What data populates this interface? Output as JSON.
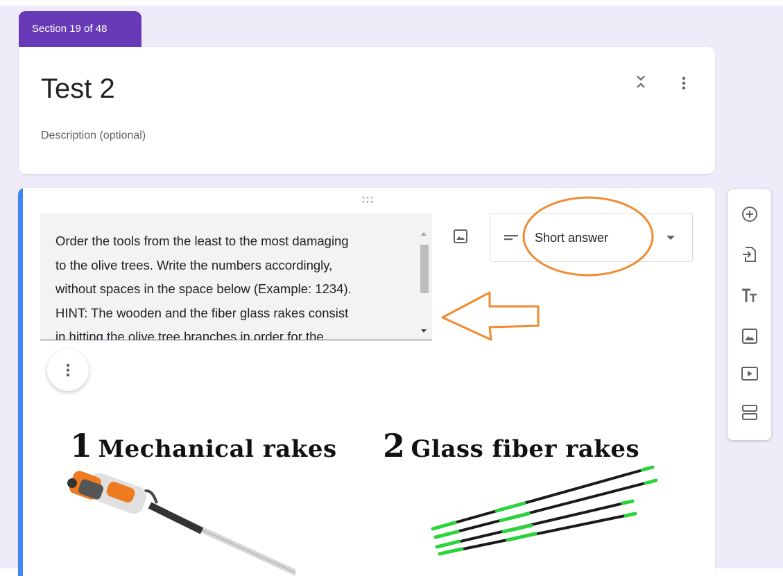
{
  "section": {
    "label": "Section 19 of 48"
  },
  "form": {
    "title": "Test 2",
    "description_placeholder": "Description (optional)"
  },
  "question": {
    "text_lines": [
      "Order the tools from the least to the most damaging",
      "to the olive trees. Write the numbers accordingly,",
      "without spaces in the space below (Example: 1234).",
      "HINT: The wooden and the fiber glass rakes consist",
      "in hitting the olive tree branches in order for the"
    ],
    "type": "Short answer"
  },
  "image": {
    "label1_num": "1",
    "label1_text": "Mechanical rakes",
    "label2_num": "2",
    "label2_text": "Glass fiber rakes"
  },
  "colors": {
    "accent": "#673ab7",
    "question_accent": "#4285f4",
    "annotation": "#f28a30",
    "rake_green": "#29d43a"
  },
  "icons": {
    "toolbar": [
      "add-question-icon",
      "import-questions-icon",
      "add-title-icon",
      "add-image-icon",
      "add-video-icon",
      "add-section-icon"
    ]
  }
}
